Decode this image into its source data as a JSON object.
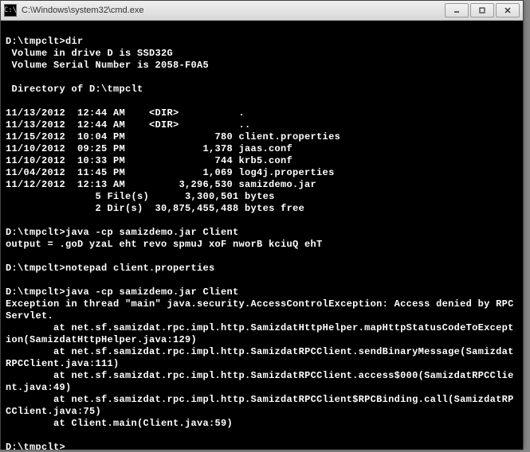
{
  "window": {
    "title": "C:\\Windows\\system32\\cmd.exe",
    "icon_glyph": "C:\\"
  },
  "terminal": {
    "lines": [
      "",
      "D:\\tmpclt>dir",
      " Volume in drive D is SSD32G",
      " Volume Serial Number is 2058-F0A5",
      "",
      " Directory of D:\\tmpclt",
      "",
      "11/13/2012  12:44 AM    <DIR>          .",
      "11/13/2012  12:44 AM    <DIR>          ..",
      "11/15/2012  10:04 PM               780 client.properties",
      "11/10/2012  09:25 PM             1,378 jaas.conf",
      "11/10/2012  10:33 PM               744 krb5.conf",
      "11/04/2012  11:45 PM             1,069 log4j.properties",
      "11/12/2012  12:13 AM         3,296,530 samizdemo.jar",
      "               5 File(s)      3,300,501 bytes",
      "               2 Dir(s)  30,875,455,488 bytes free",
      "",
      "D:\\tmpclt>java -cp samizdemo.jar Client",
      "output = .goD yzaL eht revo spmuJ xoF nworB kciuQ ehT",
      "",
      "D:\\tmpclt>notepad client.properties",
      "",
      "D:\\tmpclt>java -cp samizdemo.jar Client",
      "Exception in thread \"main\" java.security.AccessControlException: Access denied by RPC Servlet.",
      "        at net.sf.samizdat.rpc.impl.http.SamizdatHttpHelper.mapHttpStatusCodeToException(SamizdatHttpHelper.java:129)",
      "        at net.sf.samizdat.rpc.impl.http.SamizdatRPCClient.sendBinaryMessage(SamizdatRPCClient.java:111)",
      "        at net.sf.samizdat.rpc.impl.http.SamizdatRPCClient.access$000(SamizdatRPCClient.java:49)",
      "        at net.sf.samizdat.rpc.impl.http.SamizdatRPCClient$RPCBinding.call(SamizdatRPCClient.java:75)",
      "        at Client.main(Client.java:59)",
      "",
      "D:\\tmpclt>"
    ]
  }
}
